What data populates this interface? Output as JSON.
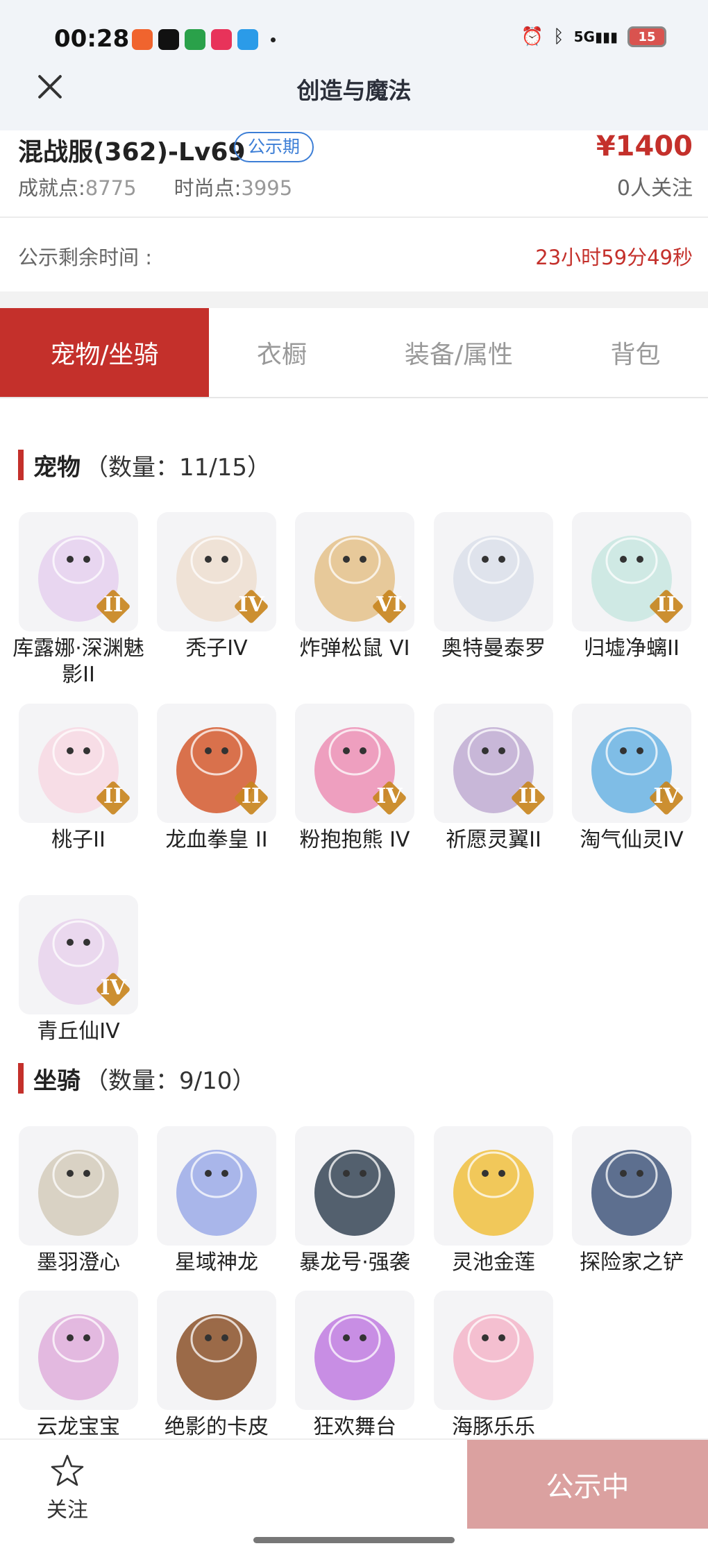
{
  "status_bar": {
    "time": "00:28",
    "battery": "15",
    "network": "5G",
    "app_icons": [
      "pdd-app-icon",
      "o-app-icon",
      "oppo-app-icon",
      "music-app-icon",
      "video-app-icon"
    ]
  },
  "nav": {
    "title": "创造与魔法"
  },
  "info": {
    "server": "混战服(362)-Lv69",
    "badge": "公示期",
    "price": "¥1400",
    "achievement_label": "成就点:",
    "achievement_value": "8775",
    "fashion_label": "时尚点:",
    "fashion_value": "3995",
    "followers": "0人关注"
  },
  "timer": {
    "label": "公示剩余时间 :",
    "value": "23小时59分49秒"
  },
  "tabs": [
    {
      "label": "宠物/坐骑",
      "active": true
    },
    {
      "label": "衣橱",
      "active": false
    },
    {
      "label": "装备/属性",
      "active": false
    },
    {
      "label": "背包",
      "active": false
    }
  ],
  "pets": {
    "title": "宠物",
    "count": "（数量：11/15）",
    "items": [
      {
        "name": "库露娜·深渊魅影II",
        "rank": "II",
        "color": "#e8d6f0"
      },
      {
        "name": "秃子IV",
        "rank": "IV",
        "color": "#efe2d6"
      },
      {
        "name": "炸弹松鼠 VI",
        "rank": "VI",
        "color": "#e7c99a"
      },
      {
        "name": "奥特曼泰罗",
        "rank": "",
        "color": "#dfe3ec"
      },
      {
        "name": "归墟净螭II",
        "rank": "II",
        "color": "#cfe9e4"
      },
      {
        "name": "桃子II",
        "rank": "II",
        "color": "#f7dde6"
      },
      {
        "name": "龙血拳皇 II",
        "rank": "II",
        "color": "#d9714c"
      },
      {
        "name": "粉抱抱熊 IV",
        "rank": "IV",
        "color": "#ee9fbf"
      },
      {
        "name": "祈愿灵翼II",
        "rank": "II",
        "color": "#c8b7d8"
      },
      {
        "name": "淘气仙灵IV",
        "rank": "IV",
        "color": "#7fbde6"
      },
      {
        "name": "青丘仙IV",
        "rank": "IV",
        "color": "#ead8ee"
      }
    ]
  },
  "mounts": {
    "title": "坐骑",
    "count": "（数量：9/10）",
    "items": [
      {
        "name": "墨羽澄心",
        "color": "#d9d2c4"
      },
      {
        "name": "星域神龙",
        "color": "#a9b6ea"
      },
      {
        "name": "暴龙号·强袭",
        "color": "#53606e"
      },
      {
        "name": "灵池金莲",
        "color": "#f1c85a"
      },
      {
        "name": "探险家之铲",
        "color": "#5d6f8f"
      },
      {
        "name": "云龙宝宝",
        "color": "#e3b9e0"
      },
      {
        "name": "绝影的卡皮",
        "color": "#9b6a48"
      },
      {
        "name": "狂欢舞台",
        "color": "#c88ee4"
      },
      {
        "name": "海豚乐乐",
        "color": "#f4bfd0"
      }
    ]
  },
  "bottom": {
    "follow_label": "关注",
    "cta_label": "公示中"
  }
}
